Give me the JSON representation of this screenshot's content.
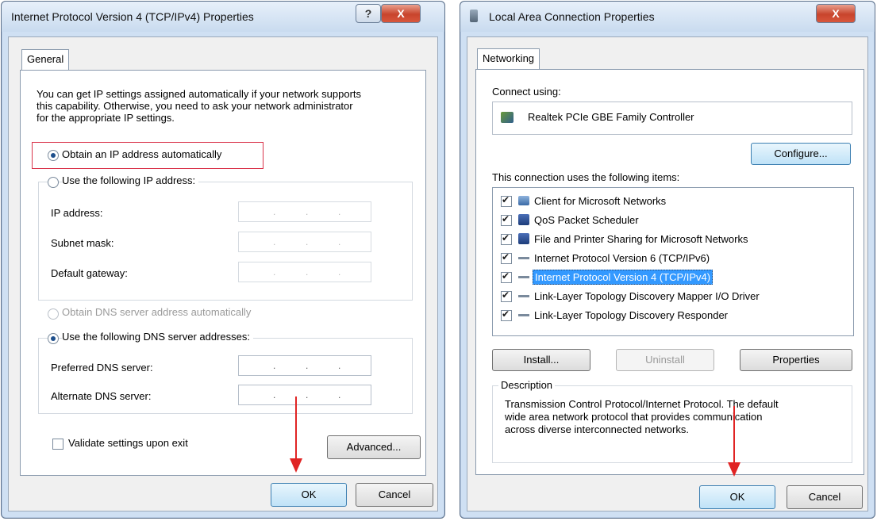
{
  "ipv4": {
    "title": "Internet Protocol Version 4 (TCP/IPv4) Properties",
    "help_glyph": "?",
    "close_glyph": "X",
    "tab": "General",
    "intro_lines": [
      "You can get IP settings assigned automatically if your network supports",
      "this capability. Otherwise, you need to ask your network administrator",
      "for the appropriate IP settings."
    ],
    "obtain_ip_auto": "Obtain an IP address automatically",
    "use_following_ip": "Use the following IP address:",
    "ip_address_label": "IP address:",
    "subnet_mask_label": "Subnet mask:",
    "default_gateway_label": "Default gateway:",
    "obtain_dns_auto": "Obtain DNS server address automatically",
    "use_following_dns": "Use the following DNS server addresses:",
    "preferred_dns_label": "Preferred DNS server:",
    "alternate_dns_label": "Alternate DNS server:",
    "validate_label": "Validate settings upon exit",
    "advanced_label": "Advanced...",
    "ok_label": "OK",
    "cancel_label": "Cancel",
    "selected_radio_ip": "obtain_ip_auto",
    "selected_radio_dns": "use_following_dns",
    "validate_checked": false
  },
  "lan": {
    "title": "Local Area Connection Properties",
    "close_glyph": "X",
    "tab": "Networking",
    "connect_using_label": "Connect using:",
    "adapter_name": "Realtek PCIe GBE Family Controller",
    "configure_label": "Configure...",
    "items_label": "This connection uses the following items:",
    "items": [
      {
        "label": "Client for Microsoft Networks",
        "checked": true,
        "icon": "network-client-icon"
      },
      {
        "label": "QoS Packet Scheduler",
        "checked": true,
        "icon": "service-icon"
      },
      {
        "label": "File and Printer Sharing for Microsoft Networks",
        "checked": true,
        "icon": "service-icon"
      },
      {
        "label": "Internet Protocol Version 6 (TCP/IPv6)",
        "checked": true,
        "icon": "protocol-icon"
      },
      {
        "label": "Internet Protocol Version 4 (TCP/IPv4)",
        "checked": true,
        "icon": "protocol-icon",
        "selected": true
      },
      {
        "label": "Link-Layer Topology Discovery Mapper I/O Driver",
        "checked": true,
        "icon": "protocol-icon"
      },
      {
        "label": "Link-Layer Topology Discovery Responder",
        "checked": true,
        "icon": "protocol-icon"
      }
    ],
    "install_label": "Install...",
    "uninstall_label": "Uninstall",
    "properties_label": "Properties",
    "description_heading": "Description",
    "description_lines": [
      "Transmission Control Protocol/Internet Protocol. The default",
      "wide area network protocol that provides communication",
      "across diverse interconnected networks."
    ],
    "ok_label": "OK",
    "cancel_label": "Cancel"
  },
  "colors": {
    "highlight": "#3399ff",
    "annotation_red": "#e02424"
  }
}
